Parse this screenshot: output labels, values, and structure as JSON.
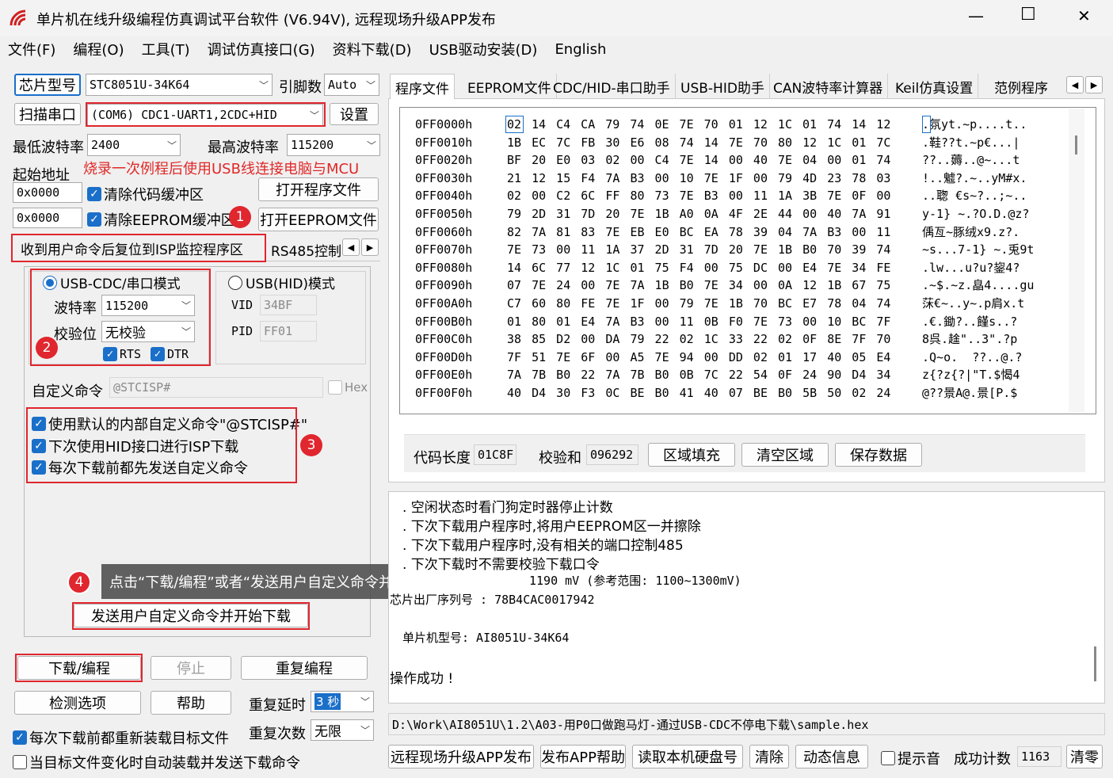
{
  "window": {
    "title": "单片机在线升级编程仿真调试平台软件 (V6.94V), 远程现场升级APP发布",
    "minimize": "—",
    "maximize": "☐",
    "close": "✕"
  },
  "menu": [
    "文件(F)",
    "编程(O)",
    "工具(T)",
    "调试仿真接口(G)",
    "资料下载(D)",
    "USB驱动安装(D)",
    "English"
  ],
  "left": {
    "chip_btn": "芯片型号",
    "chip_value": "STC8051U-34K64",
    "pins_label": "引脚数",
    "pins_value": "Auto",
    "scan_btn": "扫描串口",
    "port_value": "(COM6) CDC1-UART1,2CDC+HID",
    "settings_btn": "设置",
    "min_baud_label": "最低波特率",
    "min_baud": "2400",
    "max_baud_label": "最高波特率",
    "max_baud": "115200",
    "start_addr_label": "起始地址",
    "hint": "烧录一次例程后使用USB线连接电脑与MCU",
    "addr1": "0x0000",
    "clear_code": "清除代码缓冲区",
    "open_prog": "打开程序文件",
    "addr2": "0x0000",
    "clear_eeprom": "清除EEPROM缓冲区",
    "open_eeprom": "打开EEPROM文件",
    "tab_reset": "收到用户命令后复位到ISP监控程序区",
    "tab_rs485": "RS485控制",
    "mode_cdc": "USB-CDC/串口模式",
    "mode_hid": "USB(HID)模式",
    "baud_label": "波特率",
    "baud_value": "115200",
    "parity_label": "校验位",
    "parity_value": "无校验",
    "rts": "RTS",
    "dtr": "DTR",
    "vid_label": "VID",
    "vid": "34BF",
    "pid_label": "PID",
    "pid": "FF01",
    "custom_label": "自定义命令",
    "custom_value": "@STCISP#",
    "hex_label": "Hex",
    "opt1": "使用默认的内部自定义命令\"@STCISP#\"",
    "opt2": "下次使用HID接口进行ISP下载",
    "opt3": "每次下载前都先发送自定义命令",
    "tooltip": "点击“下载/编程”或者“发送用户自定义命令并开始下载”",
    "send_btn": "发送用户自定义命令并开始下载",
    "download_btn": "下载/编程",
    "stop_btn": "停止",
    "reprog_btn": "重复编程",
    "detect_btn": "检测选项",
    "help_btn": "帮助",
    "delay_label": "重复延时",
    "delay_value": "3 秒",
    "count_label": "重复次数",
    "count_value": "无限",
    "reload_opt": "每次下载前都重新装载目标文件",
    "auto_opt": "当目标文件变化时自动装载并发送下载命令",
    "badges": [
      "1",
      "2",
      "3",
      "4"
    ]
  },
  "right": {
    "tabs": [
      "程序文件",
      "EEPROM文件",
      "CDC/HID-串口助手",
      "USB-HID助手",
      "CAN波特率计算器",
      "Keil仿真设置",
      "范例程序"
    ],
    "hex_rows": [
      {
        "addr": "0FF0000h",
        "first": "02",
        "bytes": "14 C4 CA 79 74 0E 7E 70 01 12 1C 01 74 14 12",
        "ascii": ".氛yt.~p....t.."
      },
      {
        "addr": "0FF0010h",
        "bytes": "1B EC 7C FB 30 E6 08 74 14 7E 70 80 12 1C 01 7C",
        "ascii": ".鞋??t.~p€...|"
      },
      {
        "addr": "0FF0020h",
        "bytes": "BF 20 E0 03 02 00 C4 7E 14 00 40 7E 04 00 01 74",
        "ascii": "??..薅..@~...t"
      },
      {
        "addr": "0FF0030h",
        "bytes": "21 12 15 F4 7A B3 00 10 7E 1F 00 79 4D 23 78 03",
        "ascii": "!..魖?.~..yM#x."
      },
      {
        "addr": "0FF0040h",
        "bytes": "02 00 C2 6C FF 80 73 7E B3 00 11 1A 3B 7E 0F 00",
        "ascii": "..聦 €s~?..;~.."
      },
      {
        "addr": "0FF0050h",
        "bytes": "79 2D 31 7D 20 7E 1B A0 0A 4F 2E 44 00 40 7A 91",
        "ascii": "y-1} ~.?O.D.@z?"
      },
      {
        "addr": "0FF0060h",
        "bytes": "82 7A 81 83 7E EB E0 BC EA 78 39 04 7A B3 00 11",
        "ascii": "偊亙~豚绒x9.z?."
      },
      {
        "addr": "0FF0070h",
        "bytes": "7E 73 00 11 1A 37 2D 31 7D 20 7E 1B B0 70 39 74",
        "ascii": "~s...7-1} ~.兎9t"
      },
      {
        "addr": "0FF0080h",
        "bytes": "14 6C 77 12 1C 01 75 F4 00 75 DC 00 E4 7E 34 FE",
        "ascii": ".lw...u?u?鋆4?"
      },
      {
        "addr": "0FF0090h",
        "bytes": "07 7E 24 00 7E 7A 1B B0 7E 34 00 0A 12 1B 67 75",
        "ascii": ".~$.~z.皛4....gu"
      },
      {
        "addr": "0FF00A0h",
        "bytes": "C7 60 80 FE 7E 1F 00 79 7E 1B 70 BC E7 78 04 74",
        "ascii": "莯€~..y~.p肩x.t"
      },
      {
        "addr": "0FF00B0h",
        "bytes": "01 80 01 E4 7A B3 00 11 0B F0 7E 73 00 10 BC 7F",
        "ascii": ".€.鋤?..饉s..?"
      },
      {
        "addr": "0FF00C0h",
        "bytes": "38 85 D2 00 DA 79 22 02 1C 33 22 02 0F 8E 7F 70",
        "ascii": "8呉.趛\"..3\".?p"
      },
      {
        "addr": "0FF00D0h",
        "bytes": "7F 51 7E 6F 00 A5 7E 94 00 DD 02 01 17 40 05 E4",
        "ascii": ".Q~o.  ??..@.?"
      },
      {
        "addr": "0FF00E0h",
        "bytes": "7A 7B B0 22 7A 7B B0 0B 7C 22 54 0F 24 90 D4 34",
        "ascii": "z{?z{?|\"T.$愒4"
      },
      {
        "addr": "0FF00F0h",
        "bytes": "40 D4 30 F3 0C BE B0 41 40 07 BE B0 5B 50 02 24",
        "ascii": "@??景A@.景[P.$"
      }
    ],
    "code_len_label": "代码长度",
    "code_len": "01C8F",
    "checksum_label": "校验和",
    "checksum": "096292",
    "fill_btn": "区域填充",
    "clear_btn": "清空区域",
    "save_btn": "保存数据",
    "log": [
      ". 空闲状态时看门狗定时器停止计数",
      ". 下次下载用户程序时,将用户EEPROM区一并擦除",
      ". 下次下载用户程序时,没有相关的端口控制485",
      ". 下次下载时不需要校验下载口令"
    ],
    "log_voltage": "1190 mV (参考范围: 1100~1300mV)",
    "log_serial": "芯片出厂序列号 : 78B4CAC0017942",
    "log_model": "单片机型号: AI8051U-34K64",
    "log_ok": "操作成功 !",
    "path": "D:\\Work\\AI8051U\\1.2\\A03-用P0口做跑马灯-通过USB-CDC不停电下载\\sample.hex",
    "remote_btn": "远程现场升级APP发布",
    "publish_help_btn": "发布APP帮助",
    "disk_btn": "读取本机硬盘号",
    "clear_log_btn": "清除",
    "dynamic_btn": "动态信息",
    "beep_label": "提示音",
    "success_label": "成功计数",
    "success_count": "1163",
    "zero_btn": "清零"
  }
}
